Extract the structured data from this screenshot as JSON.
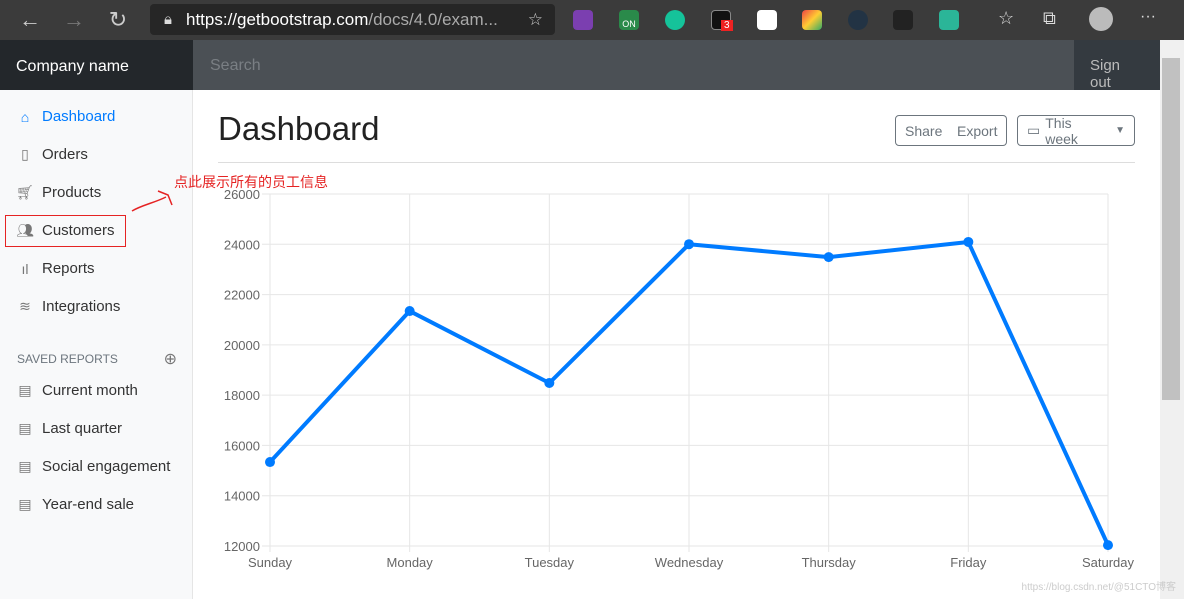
{
  "browser": {
    "url_host": "https://getbootstrap.com",
    "url_rest": "/docs/4.0/exam...",
    "badge": "3",
    "ext_on": "ON"
  },
  "topbar": {
    "brand": "Company name",
    "search_placeholder": "Search",
    "signout": "Sign out"
  },
  "sidebar": {
    "items": [
      {
        "label": "Dashboard",
        "icon": "home-icon",
        "active": true
      },
      {
        "label": "Orders",
        "icon": "file-icon"
      },
      {
        "label": "Products",
        "icon": "cart-icon"
      },
      {
        "label": "Customers",
        "icon": "users-icon"
      },
      {
        "label": "Reports",
        "icon": "bar-chart-icon"
      },
      {
        "label": "Integrations",
        "icon": "layers-icon"
      }
    ],
    "saved_heading": "SAVED REPORTS",
    "saved": [
      {
        "label": "Current month"
      },
      {
        "label": "Last quarter"
      },
      {
        "label": "Social engagement"
      },
      {
        "label": "Year-end sale"
      }
    ]
  },
  "annotation": "点此展示所有的员工信息",
  "main": {
    "title": "Dashboard",
    "share": "Share",
    "export": "Export",
    "period": "This week"
  },
  "watermark": "https://blog.csdn.net/@51CTO博客",
  "colors": {
    "accent": "#007bff",
    "annotation": "#e52323"
  },
  "chart_data": {
    "type": "line",
    "categories": [
      "Sunday",
      "Monday",
      "Tuesday",
      "Wednesday",
      "Thursday",
      "Friday",
      "Saturday"
    ],
    "values": [
      15339,
      21345,
      18483,
      24003,
      23489,
      24092,
      12034
    ],
    "ylim": [
      12000,
      26000
    ],
    "yticks": [
      12000,
      14000,
      16000,
      18000,
      20000,
      22000,
      24000,
      26000
    ],
    "grid": true,
    "color": "#007bff"
  }
}
